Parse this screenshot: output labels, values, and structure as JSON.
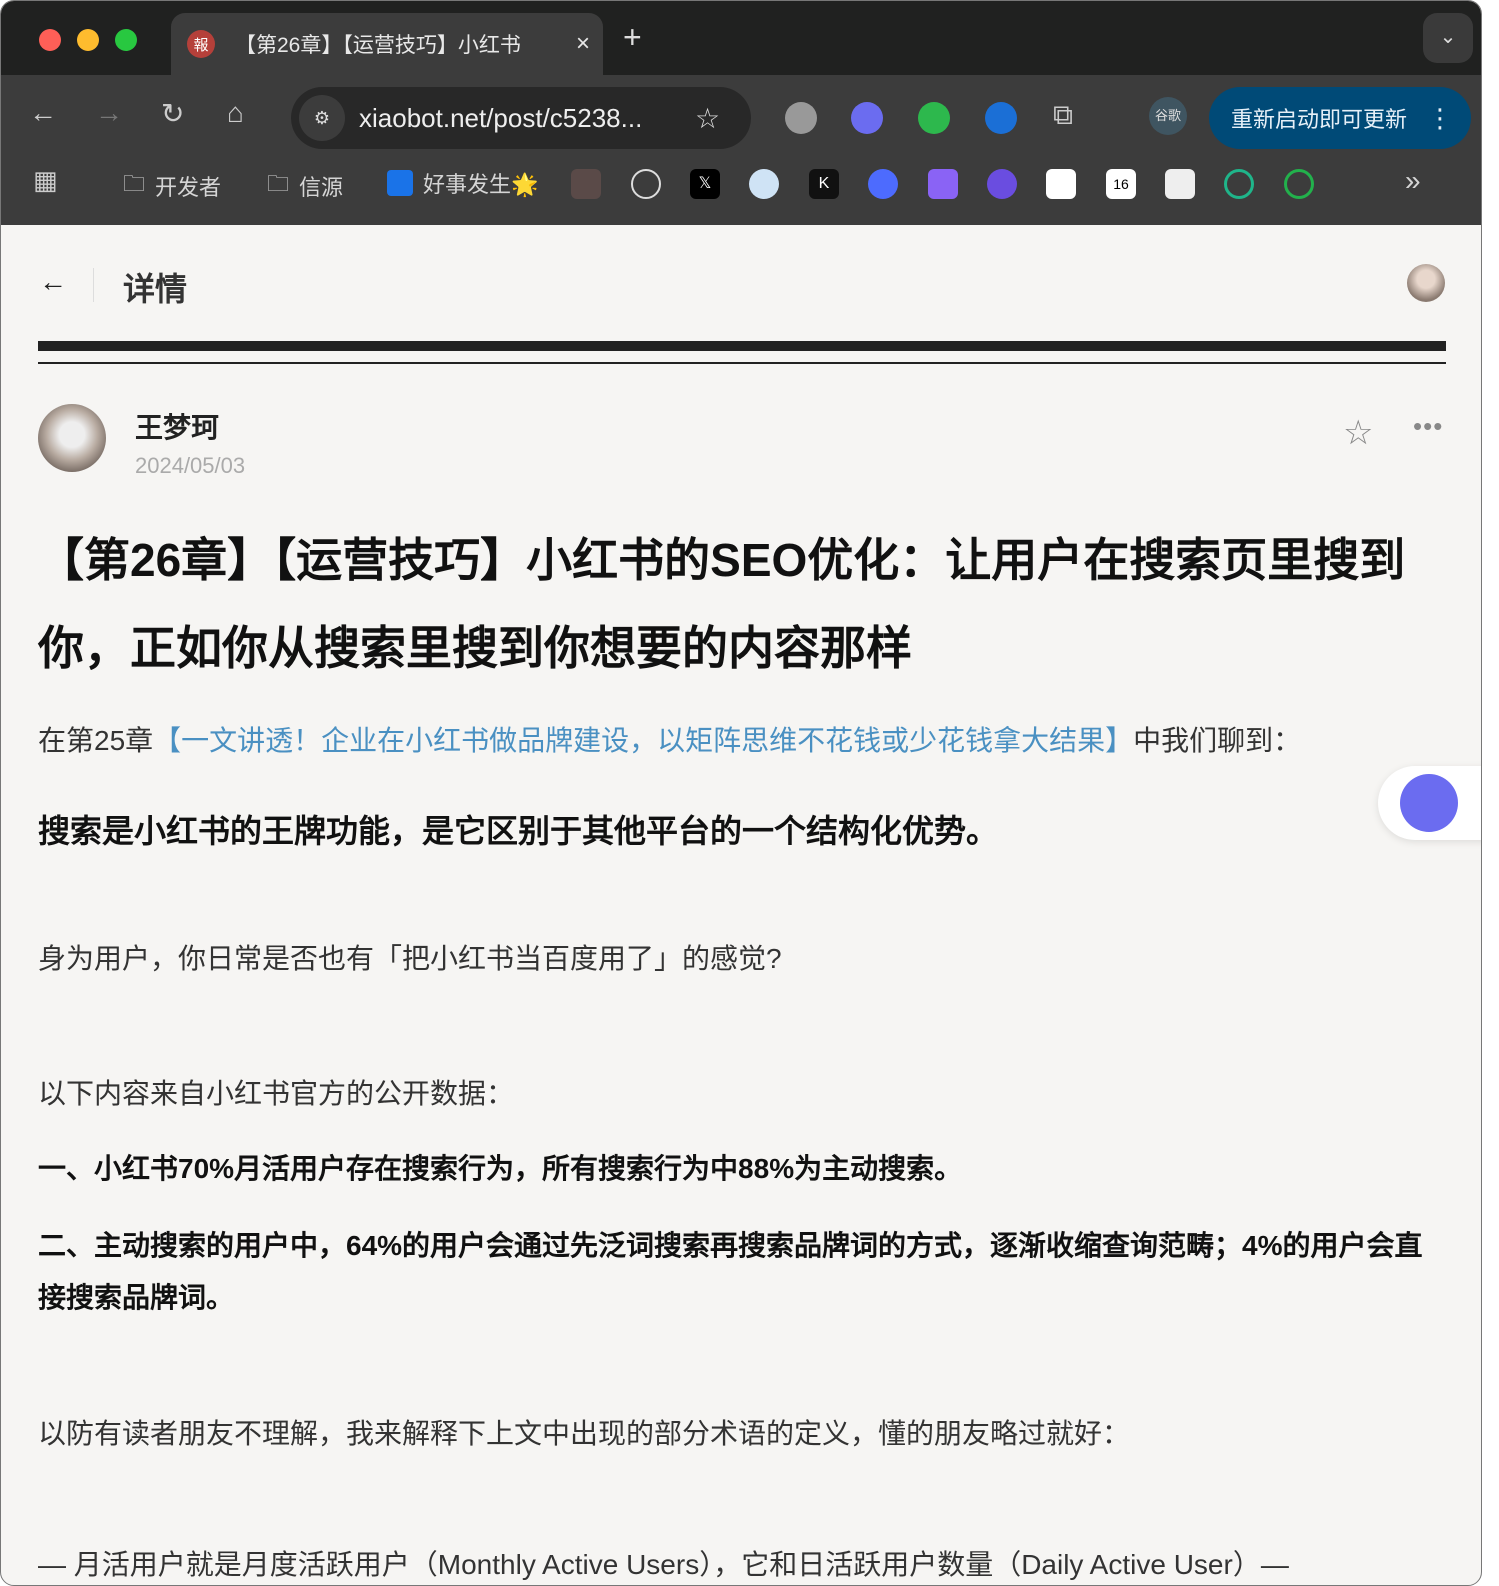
{
  "browser": {
    "tab_favicon": "報",
    "tab_title": "【第26章】【运营技巧】小红书",
    "tab_close": "×",
    "new_tab": "+",
    "tab_menu": "⌄",
    "url": "xiaobot.net/post/c5238...",
    "profile": "谷歌",
    "update_label": "重新启动即可更新",
    "bookmarks": [
      {
        "label": "开发者",
        "icon": "folder-icon"
      },
      {
        "label": "信源",
        "icon": "folder-icon"
      },
      {
        "label": "好事发生🌟",
        "icon": "bookmark-icon"
      }
    ],
    "bookmark_overflow": "»"
  },
  "header": {
    "back": "←",
    "title": "详情"
  },
  "post": {
    "author": "王梦珂",
    "date": "2024/05/03",
    "title": "【第26章】【运营技巧】小红书的SEO优化：让用户在搜索页里搜到你，正如你从搜索里搜到你想要的内容那样",
    "intro_prefix": "在第25章",
    "intro_link": "【一文讲透！企业在小红书做品牌建设，以矩阵思维不花钱或少花钱拿大结果】",
    "intro_suffix": "中我们聊到：",
    "highlight": "搜索是小红书的王牌功能，是它区别于其他平台的一个结构化优势。",
    "p1": "身为用户，你日常是否也有「把小红书当百度用了」的感觉?",
    "p2": "以下内容来自小红书官方的公开数据：",
    "p3": "一、小红书70%月活用户存在搜索行为，所有搜索行为中88%为主动搜索。",
    "p4": "二、主动搜索的用户中，64%的用户会通过先泛词搜索再搜索品牌词的方式，逐渐收缩查询范畴；4%的用户会直接搜索品牌词。",
    "p5": "以防有读者朋友不理解，我来解释下上文中出现的部分术语的定义，懂的朋友略过就好：",
    "p6": "— 月活用户就是月度活跃用户（Monthly Active Users），它和日活跃用户数量（Daily Active User）—"
  }
}
